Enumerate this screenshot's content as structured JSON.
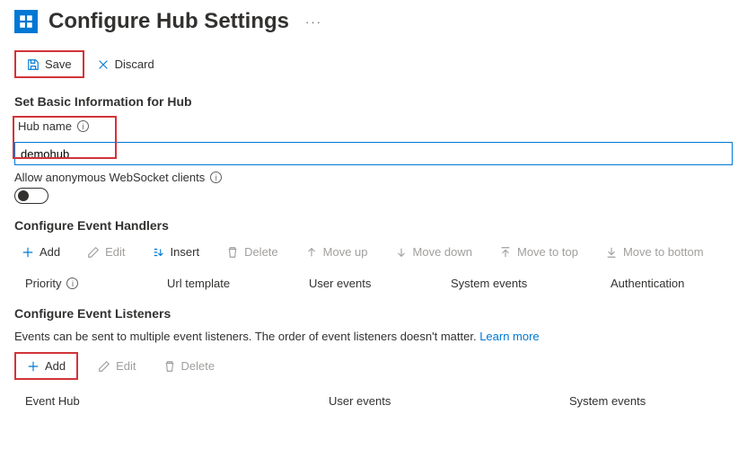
{
  "title": "Configure Hub Settings",
  "cmdbar": {
    "save": "Save",
    "discard": "Discard"
  },
  "section_basic": {
    "heading": "Set Basic Information for Hub",
    "hub_name_label": "Hub name",
    "hub_name_value": "demohub",
    "allow_anon_label": "Allow anonymous WebSocket clients"
  },
  "section_handlers": {
    "heading": "Configure Event Handlers",
    "toolbar": {
      "add": "Add",
      "edit": "Edit",
      "insert": "Insert",
      "delete": "Delete",
      "move_up": "Move up",
      "move_down": "Move down",
      "move_top": "Move to top",
      "move_bottom": "Move to bottom"
    },
    "cols": {
      "priority": "Priority",
      "url": "Url template",
      "user_events": "User events",
      "system_events": "System events",
      "auth": "Authentication"
    }
  },
  "section_listeners": {
    "heading": "Configure Event Listeners",
    "desc": "Events can be sent to multiple event listeners. The order of event listeners doesn't matter. ",
    "learn_more": "Learn more",
    "toolbar": {
      "add": "Add",
      "edit": "Edit",
      "delete": "Delete"
    },
    "cols": {
      "event_hub": "Event Hub",
      "user_events": "User events",
      "system_events": "System events"
    }
  }
}
